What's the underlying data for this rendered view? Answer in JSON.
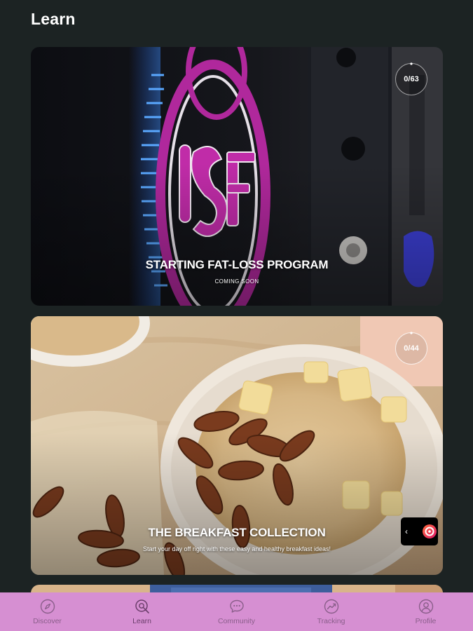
{
  "header": {
    "title": "Learn"
  },
  "cards": [
    {
      "title": "STARTING FAT-LOSS PROGRAM",
      "subtitle": "COMING SOON",
      "progress": "0/63",
      "progress_value": 0,
      "brand_color": "#b0289c"
    },
    {
      "title": "THE BREAKFAST COLLECTION",
      "subtitle": "Start your day off right with these easy and healthy breakfast ideas!",
      "progress": "0/44",
      "progress_value": 0
    }
  ],
  "side_widget": {
    "chevron": "‹",
    "icon": "app-logo-icon"
  },
  "bottom_nav": {
    "active": "Learn",
    "items": [
      {
        "label": "Discover",
        "icon": "compass-icon"
      },
      {
        "label": "Learn",
        "icon": "search-book-icon"
      },
      {
        "label": "Community",
        "icon": "chat-bubble-icon"
      },
      {
        "label": "Tracking",
        "icon": "chart-icon"
      },
      {
        "label": "Profile",
        "icon": "user-icon"
      }
    ]
  },
  "colors": {
    "background": "#1c2323",
    "nav_background": "#d68fd2",
    "nav_text": "#8a5e8a"
  }
}
